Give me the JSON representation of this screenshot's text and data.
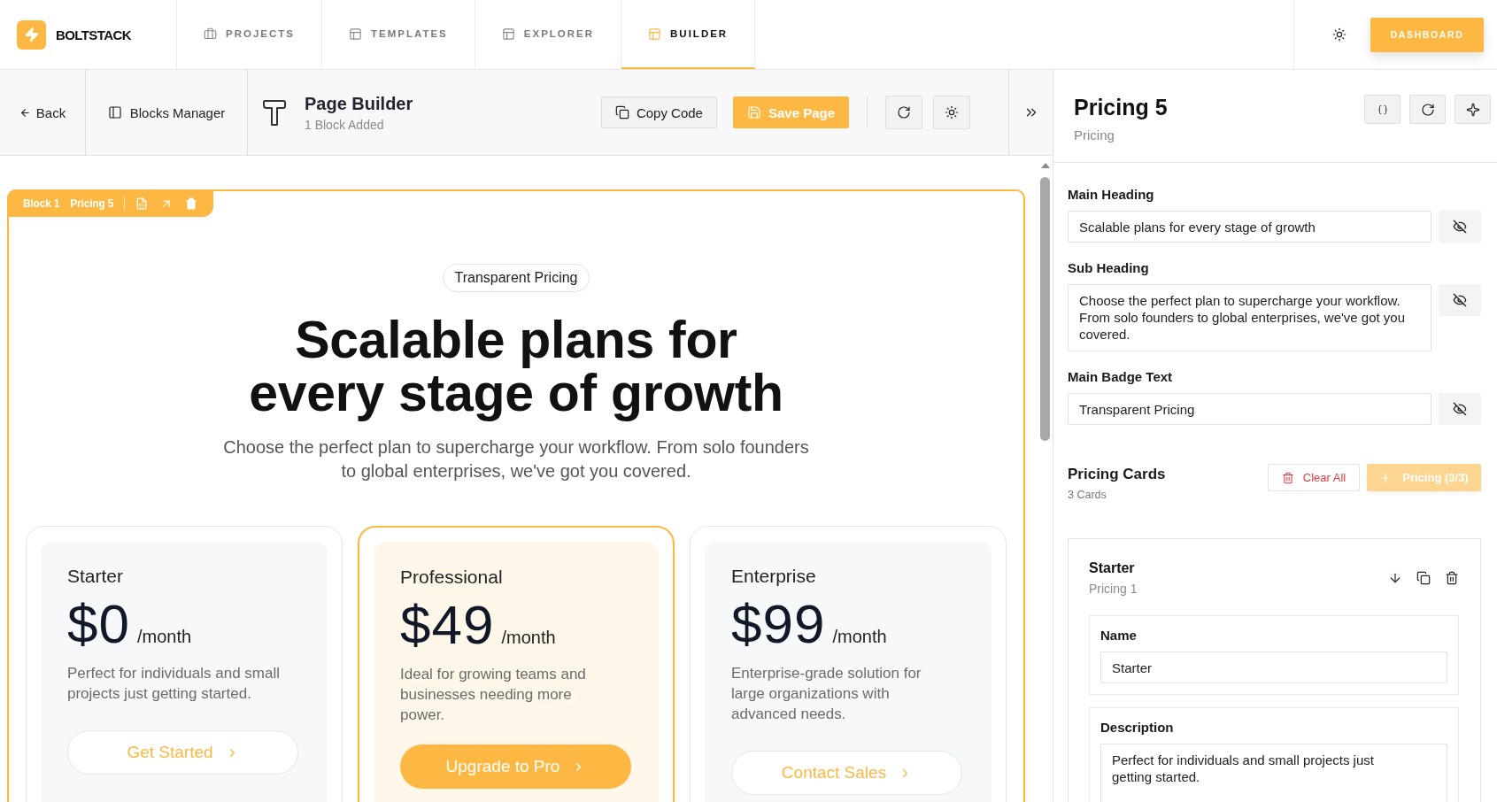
{
  "brand": {
    "name": "BOLTSTACK"
  },
  "nav_tabs": [
    {
      "label": "PROJECTS",
      "selected": false
    },
    {
      "label": "TEMPLATES",
      "selected": false
    },
    {
      "label": "EXPLORER",
      "selected": false
    },
    {
      "label": "BUILDER",
      "selected": true
    }
  ],
  "dashboard_button": "DASHBOARD",
  "toolbar": {
    "back": "Back",
    "blocks_manager": "Blocks Manager",
    "title": "Page Builder",
    "subtitle": "1 Block Added",
    "copy_code": "Copy Code",
    "save_page": "Save Page"
  },
  "block": {
    "label": "Block 1",
    "name": "Pricing 5",
    "selected": true
  },
  "preview": {
    "badge": "Transparent Pricing",
    "heading": "Scalable plans for every stage of growth",
    "subheading": "Choose the perfect plan to supercharge your workflow. From solo founders to global enterprises, we've got you covered.",
    "plans": [
      {
        "name": "Starter",
        "price": "$0",
        "period": "/month",
        "description": "Perfect for individuals and small projects just getting started.",
        "button": "Get Started",
        "highlighted": false
      },
      {
        "name": "Professional",
        "price": "$49",
        "period": "/month",
        "description": "Ideal for growing teams and businesses needing more power.",
        "button": "Upgrade to Pro",
        "highlighted": true
      },
      {
        "name": "Enterprise",
        "price": "$99",
        "period": "/month",
        "description": "Enterprise-grade solution for large organizations with advanced needs.",
        "button": "Contact Sales",
        "highlighted": false
      }
    ]
  },
  "inspector": {
    "title": "Pricing 5",
    "subtitle": "Pricing",
    "fields": [
      {
        "label": "Main Heading",
        "value": "Scalable plans for every stage of growth",
        "kind": "input"
      },
      {
        "label": "Sub Heading",
        "value": "Choose the perfect plan to supercharge your workflow. From solo founders to global enterprises, we've got you covered.",
        "kind": "textarea"
      },
      {
        "label": "Main Badge Text",
        "value": "Transparent Pricing",
        "kind": "input"
      }
    ],
    "cards_section": {
      "title": "Pricing Cards",
      "count": "3 Cards",
      "clear_all": "Clear All",
      "add_button": {
        "label": "Pricing (3/3)",
        "disabled": true
      }
    },
    "card_editor": {
      "title": "Starter",
      "subtitle": "Pricing 1",
      "fields": [
        {
          "label": "Name",
          "value": "Starter",
          "kind": "input"
        },
        {
          "label": "Description",
          "value": "Perfect for individuals and small projects just getting started.",
          "kind": "textarea"
        }
      ]
    }
  }
}
